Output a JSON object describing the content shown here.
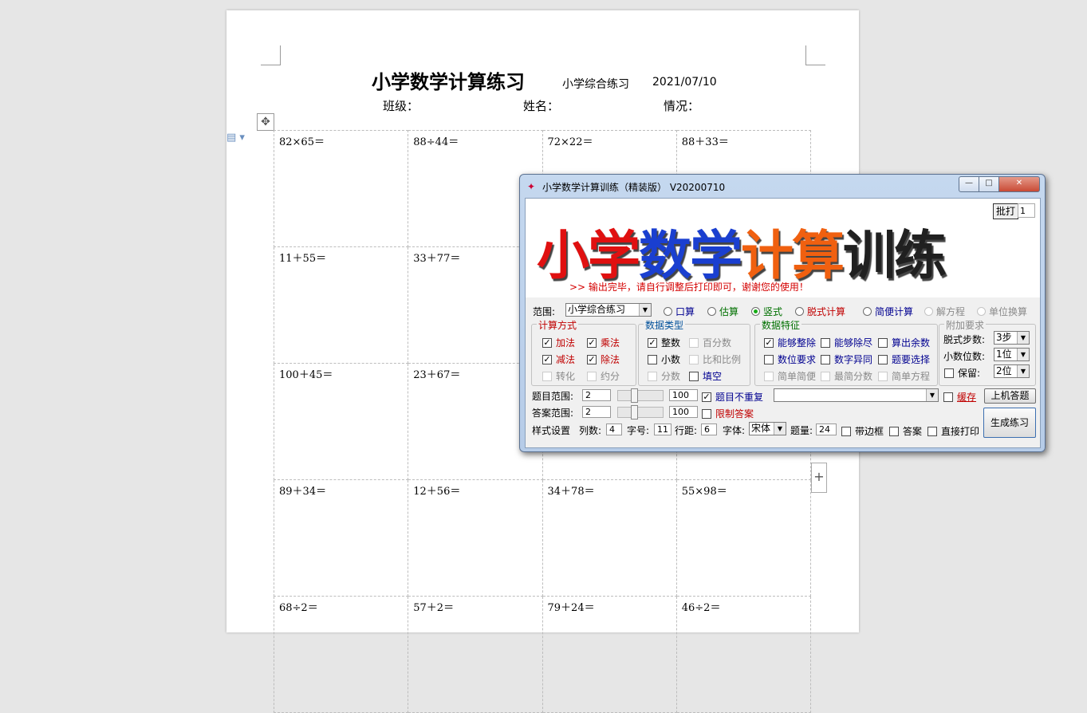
{
  "document": {
    "title": "小学数学计算练习",
    "subtitle": "小学综合练习",
    "date": "2021/07/10",
    "fields": [
      "班级：",
      "姓名：",
      "情况："
    ],
    "problems": [
      [
        "82×65＝",
        "88÷44＝",
        "72×22＝",
        "88＋33＝"
      ],
      [
        "11＋55＝",
        "33＋77＝",
        "",
        ""
      ],
      [
        "100＋45＝",
        "23＋67＝",
        "",
        ""
      ],
      [
        "89＋34＝",
        "12＋56＝",
        "34＋78＝",
        "55×98＝"
      ],
      [
        "68÷2＝",
        "57＋2＝",
        "79＋24＝",
        "46÷2＝"
      ]
    ]
  },
  "dialog": {
    "title": "小学数学计算训练（精装版） V20200710",
    "window_buttons": [
      "—",
      "□",
      "✕"
    ],
    "banner": {
      "title_chars": [
        "小",
        "学",
        "数",
        "学",
        "计",
        "算",
        "训",
        "练"
      ],
      "title_colors": [
        "#e01010",
        "#e01010",
        "#1a3fd0",
        "#1a3fd0",
        "#f06010",
        "#f06010",
        "#202020",
        "#202020"
      ],
      "message": ">> 输出完毕，请自行调整后打印即可，谢谢您的使用！"
    },
    "print_button": "批打",
    "print_count": "1",
    "range_label": "范围:",
    "range_value": "小学综合练习",
    "modes": [
      {
        "label": "口算",
        "selected": false,
        "enabled": true
      },
      {
        "label": "估算",
        "selected": false,
        "enabled": true
      },
      {
        "label": "竖式",
        "selected": true,
        "enabled": true
      },
      {
        "label": "脱式计算",
        "selected": false,
        "enabled": true
      },
      {
        "label": "简便计算",
        "selected": false,
        "enabled": true
      },
      {
        "label": "解方程",
        "selected": false,
        "enabled": false
      },
      {
        "label": "单位换算",
        "selected": false,
        "enabled": false
      }
    ],
    "calc_method": {
      "title": "计算方式",
      "items": [
        {
          "label": "加法",
          "checked": true,
          "enabled": true
        },
        {
          "label": "乘法",
          "checked": true,
          "enabled": true
        },
        {
          "label": "减法",
          "checked": true,
          "enabled": true
        },
        {
          "label": "除法",
          "checked": true,
          "enabled": true
        },
        {
          "label": "转化",
          "checked": false,
          "enabled": false
        },
        {
          "label": "约分",
          "checked": false,
          "enabled": false
        }
      ]
    },
    "data_type": {
      "title": "数据类型",
      "items": [
        {
          "label": "整数",
          "checked": true,
          "enabled": true
        },
        {
          "label": "百分数",
          "checked": false,
          "enabled": false
        },
        {
          "label": "小数",
          "checked": false,
          "enabled": true
        },
        {
          "label": "比和比例",
          "checked": false,
          "enabled": false
        },
        {
          "label": "分数",
          "checked": false,
          "enabled": false
        },
        {
          "label": "填空",
          "checked": false,
          "enabled": true
        }
      ]
    },
    "data_feature": {
      "title": "数据特征",
      "items": [
        {
          "label": "能够整除",
          "checked": true,
          "enabled": true
        },
        {
          "label": "能够除尽",
          "checked": false,
          "enabled": true
        },
        {
          "label": "算出余数",
          "checked": false,
          "enabled": true
        },
        {
          "label": "数位要求",
          "checked": false,
          "enabled": true
        },
        {
          "label": "数字异同",
          "checked": false,
          "enabled": true
        },
        {
          "label": "题要选择",
          "checked": false,
          "enabled": true
        },
        {
          "label": "简单简便",
          "checked": false,
          "enabled": false
        },
        {
          "label": "最简分数",
          "checked": false,
          "enabled": false
        },
        {
          "label": "简单方程",
          "checked": false,
          "enabled": false
        }
      ]
    },
    "extra": {
      "title": "附加要求",
      "steps_label": "脱式步数:",
      "steps_value": "3步",
      "decimals_label": "小数位数:",
      "decimals_value": "1位",
      "keep_label": "保留:",
      "keep_value": "2位"
    },
    "question_range": {
      "label": "题目范围:",
      "min": "2",
      "max": "100",
      "slider_fraction": 0.35
    },
    "answer_range": {
      "label": "答案范围:",
      "min": "2",
      "max": "100",
      "slider_fraction": 0.35
    },
    "no_repeat": {
      "label": "题目不重复",
      "checked": true
    },
    "limit_answer": {
      "label": "限制答案",
      "checked": false
    },
    "cache_label": "缓存",
    "online_button": "上机答题",
    "generate_button": "生成练习",
    "style": {
      "label": "样式设置",
      "columns_label": "列数:",
      "columns_value": "4",
      "fontsize_label": "字号:",
      "fontsize_value": "11",
      "linespacing_label": "行距:",
      "linespacing_value": "6",
      "font_label": "字体:",
      "font_value": "宋体",
      "count_label": "题量:",
      "count_value": "24",
      "border_label": "带边框",
      "answer_label": "答案",
      "print_label": "直接打印"
    }
  }
}
